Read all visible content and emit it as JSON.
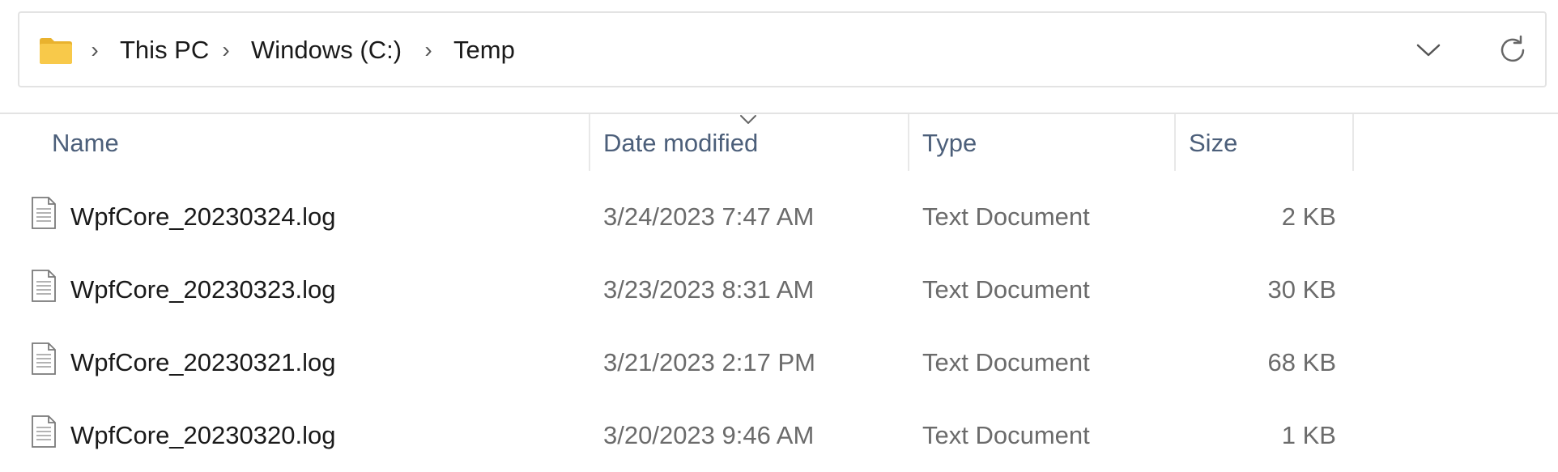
{
  "address_bar": {
    "icon": "folder-icon",
    "breadcrumbs": [
      "This PC",
      "Windows (C:)",
      "Temp"
    ],
    "separator": "›",
    "dropdown_icon": "chevron-down-icon",
    "refresh_icon": "refresh-icon"
  },
  "columns": {
    "name": "Name",
    "date_modified": "Date modified",
    "type": "Type",
    "size": "Size",
    "sorted_by": "date_modified"
  },
  "files": [
    {
      "icon": "text-file-icon",
      "name": "WpfCore_20230324.log",
      "date_modified": "3/24/2023 7:47 AM",
      "type": "Text Document",
      "size": "2 KB"
    },
    {
      "icon": "text-file-icon",
      "name": "WpfCore_20230323.log",
      "date_modified": "3/23/2023 8:31 AM",
      "type": "Text Document",
      "size": "30 KB"
    },
    {
      "icon": "text-file-icon",
      "name": "WpfCore_20230321.log",
      "date_modified": "3/21/2023 2:17 PM",
      "type": "Text Document",
      "size": "68 KB"
    },
    {
      "icon": "text-file-icon",
      "name": "WpfCore_20230320.log",
      "date_modified": "3/20/2023 9:46 AM",
      "type": "Text Document",
      "size": "1 KB"
    }
  ],
  "colors": {
    "folder_yellow": "#f8c94a",
    "folder_dark": "#e9b22e",
    "header_text": "#4c5f7a",
    "secondary_text": "#6b6b6b"
  }
}
